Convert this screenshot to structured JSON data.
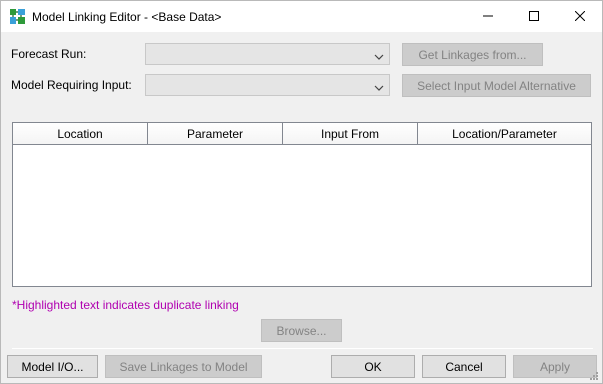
{
  "window": {
    "title": "Model Linking Editor - <Base Data>"
  },
  "form": {
    "forecast_run_label": "Forecast Run:",
    "forecast_run_value": "",
    "get_linkages_label": "Get Linkages from...",
    "model_requiring_input_label": "Model Requiring Input:",
    "model_requiring_input_value": "",
    "select_alternative_label": "Select Input Model Alternative"
  },
  "table": {
    "columns": [
      "Location",
      "Parameter",
      "Input From",
      "Location/Parameter"
    ],
    "rows": []
  },
  "note": {
    "text": "*Highlighted text indicates duplicate linking",
    "color": "#b000b0"
  },
  "browse_label": "Browse...",
  "footer": {
    "model_io_label": "Model I/O...",
    "save_linkages_label": "Save Linkages to Model",
    "ok_label": "OK",
    "cancel_label": "Cancel",
    "apply_label": "Apply"
  },
  "icons": {
    "app": "model-linking-app-icon",
    "minimize": "minimize-icon",
    "maximize": "maximize-icon",
    "close": "close-icon",
    "dropdown": "chevron-down-icon",
    "grip": "resize-grip-icon"
  }
}
